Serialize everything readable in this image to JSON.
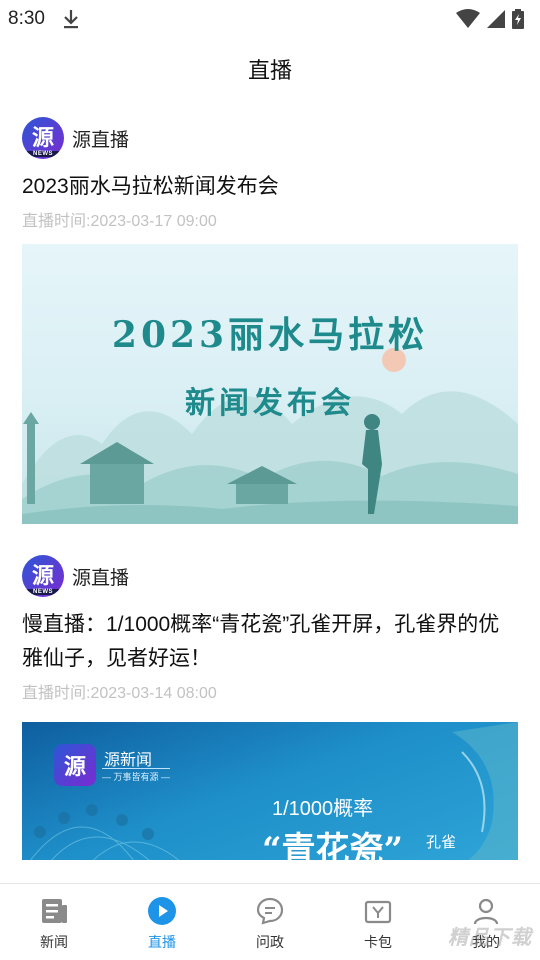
{
  "status_bar": {
    "time": "8:30",
    "icons": [
      "download-icon",
      "wifi-icon",
      "signal-icon",
      "battery-icon"
    ]
  },
  "header": {
    "title": "直播"
  },
  "feed": {
    "items": [
      {
        "source": {
          "logo_char": "源",
          "logo_sub": "NEWS",
          "name": "源直播"
        },
        "title": "2023丽水马拉松新闻发布会",
        "time": "直播时间:2023-03-17 09:00",
        "image": {
          "line1": "2023丽水马拉松",
          "line2": "新闻发布会"
        }
      },
      {
        "source": {
          "logo_char": "源",
          "logo_sub": "NEWS",
          "name": "源直播"
        },
        "title": "慢直播：1/1000概率“青花瓷”孔雀开屏，孔雀界的优雅仙子，见者好运！",
        "time": "直播时间:2023-03-14 08:00",
        "image": {
          "logo_char": "源",
          "brand": "源新闻",
          "brand_sub": "— 万事皆有源 —",
          "promo1": "1/1000概率",
          "promo2": "“青花瓷”",
          "promo3": "孔雀"
        }
      }
    ]
  },
  "bottom_nav": {
    "items": [
      {
        "label": "新闻",
        "icon": "newspaper-icon",
        "active": false
      },
      {
        "label": "直播",
        "icon": "play-circle-icon",
        "active": true
      },
      {
        "label": "问政",
        "icon": "chat-bubble-icon",
        "active": false
      },
      {
        "label": "卡包",
        "icon": "card-wallet-icon",
        "active": false
      },
      {
        "label": "我的",
        "icon": "user-icon",
        "active": false
      }
    ],
    "active_color": "#1e94e8"
  },
  "watermark": "精品下载"
}
